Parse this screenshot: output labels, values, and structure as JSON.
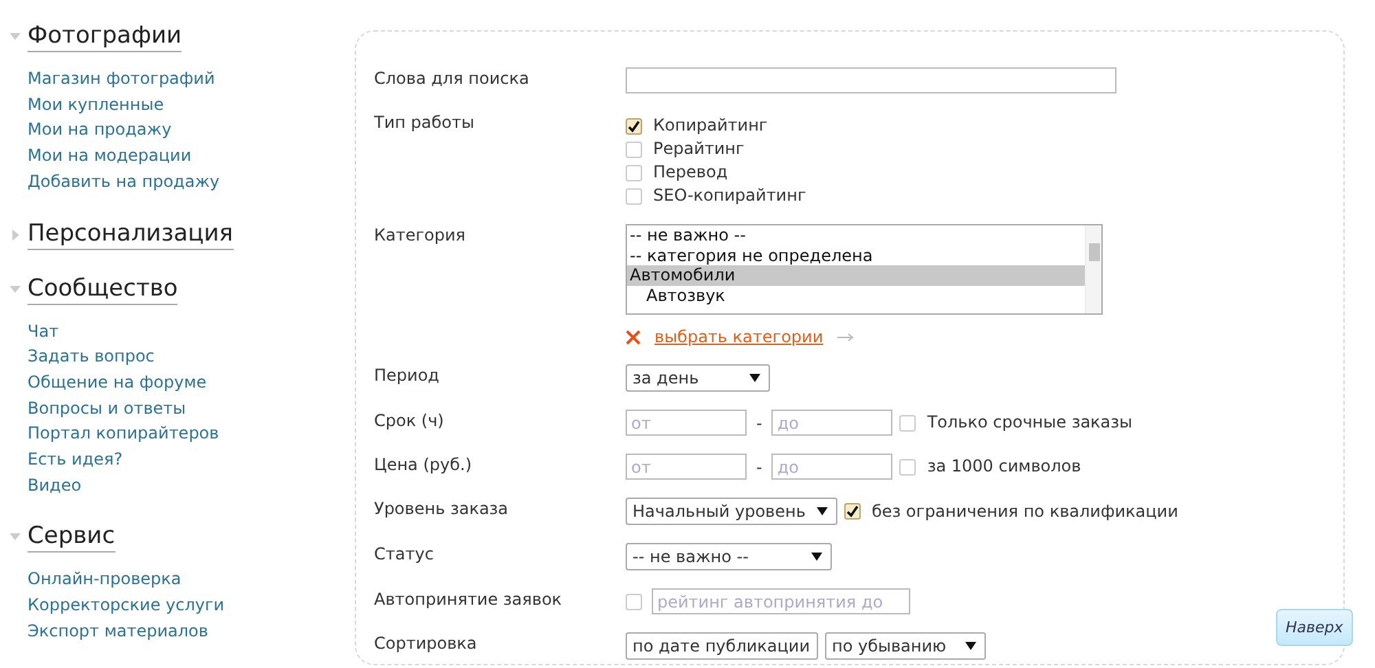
{
  "sidebar": {
    "sections": [
      {
        "title": "Фотографии",
        "expanded": true,
        "items": [
          "Магазин фотографий",
          "Мои купленные",
          "Мои на продажу",
          "Мои на модерации",
          "Добавить на продажу"
        ]
      },
      {
        "title": "Персонализация",
        "expanded": false
      },
      {
        "title": "Сообщество",
        "expanded": true,
        "items": [
          "Чат",
          "Задать вопрос",
          "Общение на форуме",
          "Вопросы и ответы",
          "Портал копирайтеров",
          "Есть идея?",
          "Видео"
        ]
      },
      {
        "title": "Сервис",
        "expanded": true,
        "items": [
          "Онлайн-проверка",
          "Корректорские услуги",
          "Экспорт материалов"
        ]
      }
    ]
  },
  "form": {
    "fields": [
      {
        "kind": "text",
        "label": "Слова для поиска"
      },
      {
        "kind": "checklist",
        "label": "Тип работы",
        "options": [
          {
            "label": "Копирайтинг",
            "checked": true
          },
          {
            "label": "Рерайтинг",
            "checked": false
          },
          {
            "label": "Перевод",
            "checked": false
          },
          {
            "label": "SEO-копирайтинг",
            "checked": false
          }
        ]
      },
      {
        "kind": "listbox",
        "label": "Категория",
        "options": [
          {
            "label": "-- не важно --",
            "selected": false
          },
          {
            "label": "-- категория не определена",
            "selected": false
          },
          {
            "label": "Автомобили",
            "selected": true,
            "children": [
              {
                "label": "Автозвук",
                "selected": false
              }
            ]
          }
        ],
        "link": "выбрать категории"
      },
      {
        "kind": "select",
        "label": "Период",
        "selects": [
          "за день"
        ]
      },
      {
        "kind": "range",
        "label": "Срок (ч)",
        "inputs": [
          {
            "placeholder": "от"
          },
          {
            "placeholder": "до"
          }
        ],
        "separator": "-",
        "check": {
          "label": "Только срочные заказы",
          "checked": false
        }
      },
      {
        "kind": "range",
        "label": "Цена (руб.)",
        "inputs": [
          {
            "placeholder": "от"
          },
          {
            "placeholder": "до"
          }
        ],
        "separator": "-",
        "check": {
          "label": "за 1000 символов",
          "checked": false
        }
      },
      {
        "kind": "select",
        "label": "Уровень заказа",
        "selects": [
          "Начальный уровень"
        ],
        "check": {
          "label": "без ограничения по квалификации",
          "checked": true
        }
      },
      {
        "kind": "select",
        "label": "Статус",
        "selects": [
          "-- не важно --"
        ]
      },
      {
        "kind": "check_input",
        "label": "Автопринятие заявок",
        "check": {
          "checked": false
        },
        "placeholder": "рейтинг автопринятия до"
      },
      {
        "kind": "select",
        "label": "Сортировка",
        "selects": [
          "по дате публикации",
          "по убыванию"
        ]
      }
    ]
  },
  "back_to_top": {
    "label": "Наверх"
  }
}
